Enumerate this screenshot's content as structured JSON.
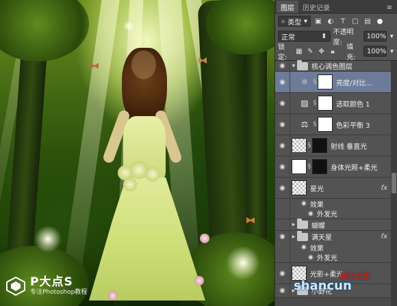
{
  "panel": {
    "tabs": [
      "图层",
      "历史记录"
    ],
    "filter_kind": "类型",
    "blend_mode": "正常",
    "opacity_label": "不透明度:",
    "opacity_value": "100%",
    "lock_label": "锁定:",
    "fill_label": "填充:",
    "fill_value": "100%",
    "layers": [
      {
        "type": "group-open",
        "name": "核心调色图层"
      },
      {
        "type": "adjust",
        "icon": "sun-icon",
        "name": "亮度/对比...",
        "active": true
      },
      {
        "type": "adjust",
        "icon": "selective-color-icon",
        "name": "选取颜色 1"
      },
      {
        "type": "adjust",
        "icon": "color-balance-icon",
        "name": "色彩平衡 3"
      },
      {
        "type": "masked",
        "name": "射线 垂直光"
      },
      {
        "type": "masked",
        "name": "身体光照+柔光"
      },
      {
        "type": "pixel",
        "name": "星光",
        "fx": "fx"
      },
      {
        "type": "sub",
        "name": "效果"
      },
      {
        "type": "sub2",
        "name": "外发光"
      },
      {
        "type": "group-closed",
        "name": "蝴蝶"
      },
      {
        "type": "group-closed-fx",
        "name": "满天星",
        "fx": "fx"
      },
      {
        "type": "sub",
        "name": "效果"
      },
      {
        "type": "sub2",
        "name": "外发光"
      },
      {
        "type": "pixel",
        "name": "光影+柔光"
      },
      {
        "type": "group-closed",
        "name": "小野花"
      }
    ]
  },
  "logo": {
    "title": "P大点S",
    "subtitle": "专注Photoshop教程"
  },
  "watermark": {
    "text": "shancun",
    "sub": "脚本之家"
  },
  "colors": {
    "panel": "#535353",
    "active_layer": "#6c7c98"
  }
}
